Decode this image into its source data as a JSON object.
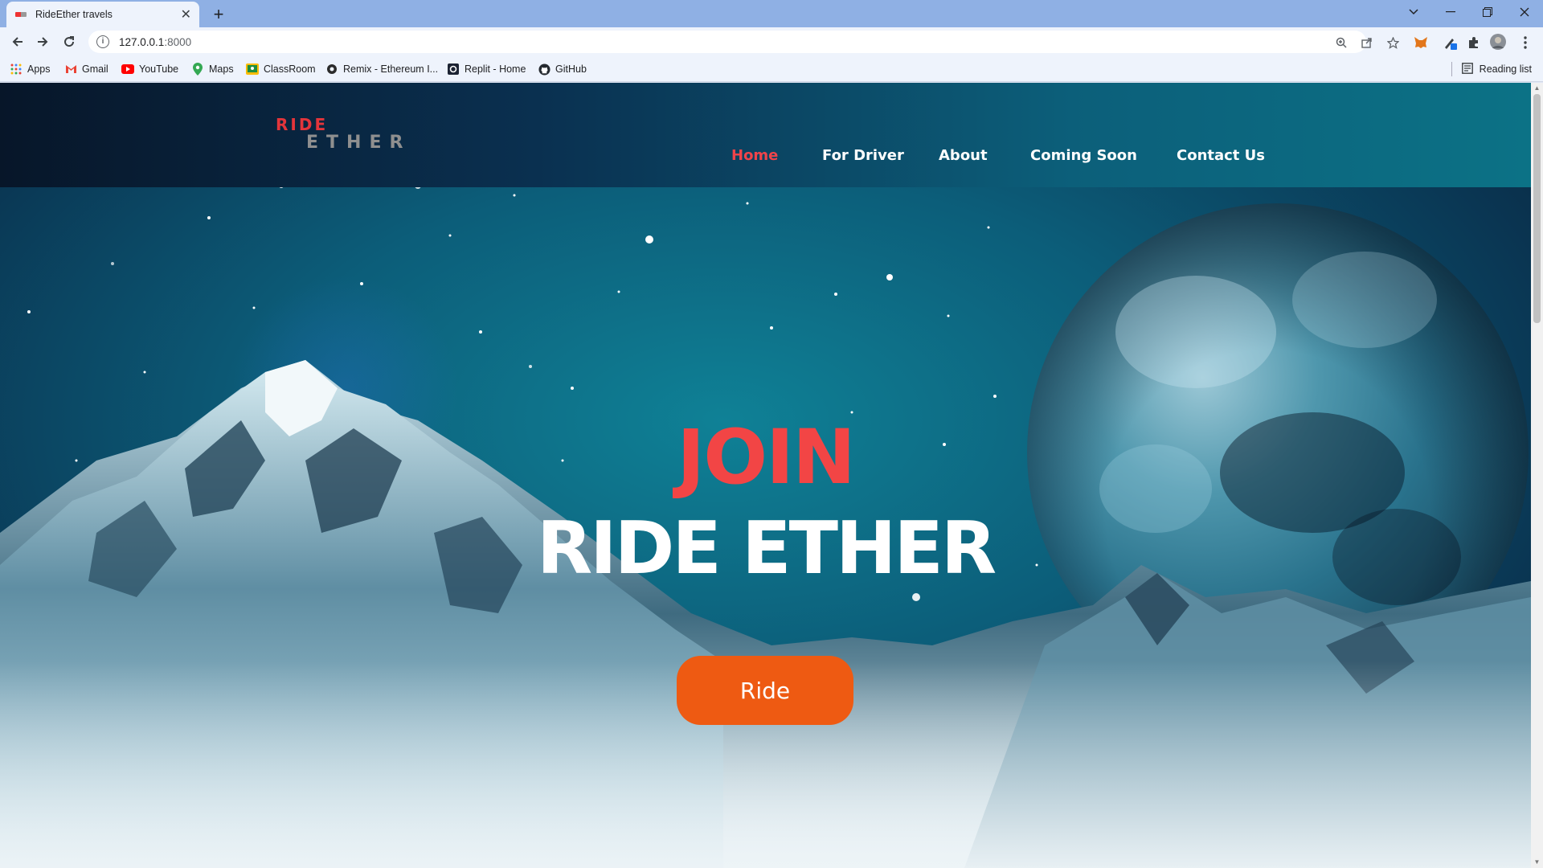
{
  "browser": {
    "tab_title": "RideEther travels",
    "url_host": "127.0.0.1",
    "url_port": ":8000",
    "bookmarks": [
      {
        "label": "Apps",
        "icon": "apps-grid-icon"
      },
      {
        "label": "Gmail",
        "icon": "gmail-icon"
      },
      {
        "label": "YouTube",
        "icon": "youtube-icon"
      },
      {
        "label": "Maps",
        "icon": "maps-pin-icon"
      },
      {
        "label": "ClassRoom",
        "icon": "classroom-icon"
      },
      {
        "label": "Remix - Ethereum I...",
        "icon": "remix-icon"
      },
      {
        "label": "Replit - Home",
        "icon": "replit-icon"
      },
      {
        "label": "GitHub",
        "icon": "github-icon"
      }
    ],
    "reading_list": "Reading list"
  },
  "site": {
    "logo_top": "RIDE",
    "logo_bottom": "ETHER",
    "nav": [
      {
        "label": "Home",
        "active": true
      },
      {
        "label": "For Driver",
        "active": false
      },
      {
        "label": "About",
        "active": false
      },
      {
        "label": "Coming Soon",
        "active": false
      },
      {
        "label": "Contact Us",
        "active": false
      }
    ]
  },
  "hero": {
    "kicker": "JOIN",
    "title": "RIDE ETHER",
    "button": "Ride"
  },
  "colors": {
    "accent_red": "#f24545",
    "button_orange": "#ee5a12",
    "header_teal": "#0c7286"
  }
}
